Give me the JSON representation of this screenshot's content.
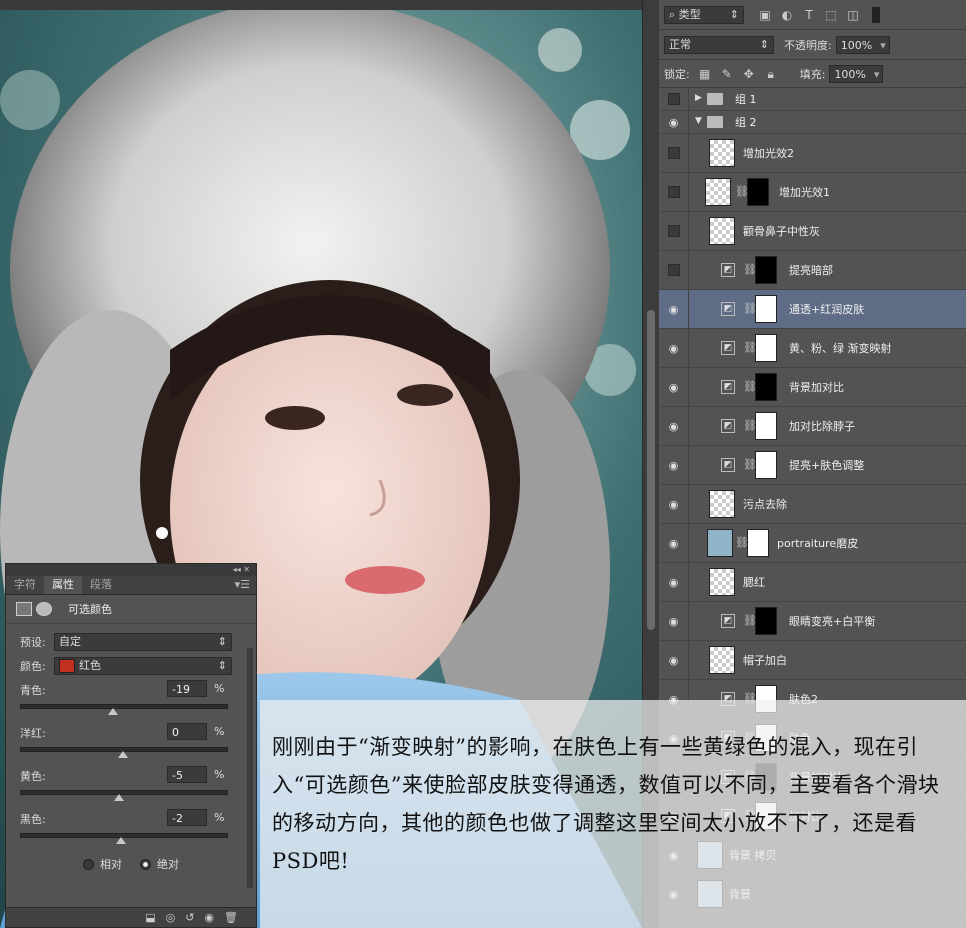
{
  "layers_panel": {
    "filter_label": "类型",
    "blend_mode": "正常",
    "opacity_label": "不透明度:",
    "opacity_value": "100%",
    "lock_label": "锁定:",
    "fill_label": "填充:",
    "fill_value": "100%",
    "layers": [
      {
        "name": "组 1",
        "type": "group",
        "visible": false,
        "expanded": false
      },
      {
        "name": "组 2",
        "type": "group",
        "visible": true,
        "expanded": true
      },
      {
        "name": "增加光效2",
        "type": "pixel",
        "visible": false
      },
      {
        "name": "增加光效1",
        "type": "pixel-mask",
        "visible": false
      },
      {
        "name": "颧骨鼻子中性灰",
        "type": "pixel",
        "visible": false
      },
      {
        "name": "提亮暗部",
        "type": "adjustment",
        "visible": false
      },
      {
        "name": "通透+红润皮肤",
        "type": "adjustment",
        "visible": true,
        "active": true
      },
      {
        "name": "黄、粉、绿 渐变映射",
        "type": "adjustment",
        "visible": true
      },
      {
        "name": "背景加对比",
        "type": "adjustment",
        "visible": true
      },
      {
        "name": "加对比除脖子",
        "type": "adjustment",
        "visible": true
      },
      {
        "name": "提亮+肤色调整",
        "type": "adjustment",
        "visible": true
      },
      {
        "name": "污点去除",
        "type": "pixel",
        "visible": true
      },
      {
        "name": "portraiture磨皮",
        "type": "photo-mask",
        "visible": true
      },
      {
        "name": "腮红",
        "type": "pixel",
        "visible": true
      },
      {
        "name": "眼睛变亮+白平衡",
        "type": "adjustment",
        "visible": true
      },
      {
        "name": "帽子加白",
        "type": "pixel",
        "visible": true
      },
      {
        "name": "肤色2",
        "type": "adjustment",
        "visible": true
      },
      {
        "name": "肤色",
        "type": "adjustment",
        "visible": true
      },
      {
        "name": "背景加对比",
        "type": "adjustment",
        "visible": true
      },
      {
        "name": "加对比",
        "type": "adjustment",
        "visible": true
      },
      {
        "name": "背景 拷贝",
        "type": "photo",
        "visible": true
      },
      {
        "name": "背景",
        "type": "photo",
        "visible": true
      }
    ]
  },
  "properties_panel": {
    "tabs": [
      "字符",
      "属性",
      "段落"
    ],
    "active_tab": "属性",
    "title": "可选颜色",
    "preset_label": "预设:",
    "preset_value": "自定",
    "color_label": "颜色:",
    "color_value": "红色",
    "color_swatch": "#c1301f",
    "sliders": [
      {
        "label": "青色:",
        "value": "-19",
        "fraction": 0.45
      },
      {
        "label": "洋红:",
        "value": "0",
        "fraction": 0.5
      },
      {
        "label": "黄色:",
        "value": "-5",
        "fraction": 0.48
      },
      {
        "label": "黑色:",
        "value": "-2",
        "fraction": 0.49
      }
    ],
    "unit": "%",
    "method_relative": "相对",
    "method_absolute": "绝对",
    "method_selected": "绝对"
  },
  "caption": {
    "text": "刚刚由于“渐变映射”的影响，在肤色上有一些黄绿色的混入，现在引入“可选颜色”来使脸部皮肤变得通透，数值可以不同，主要看各个滑块的移动方向，其他的颜色也做了调整这里空间太小放不下了，还是看PSD吧!"
  }
}
